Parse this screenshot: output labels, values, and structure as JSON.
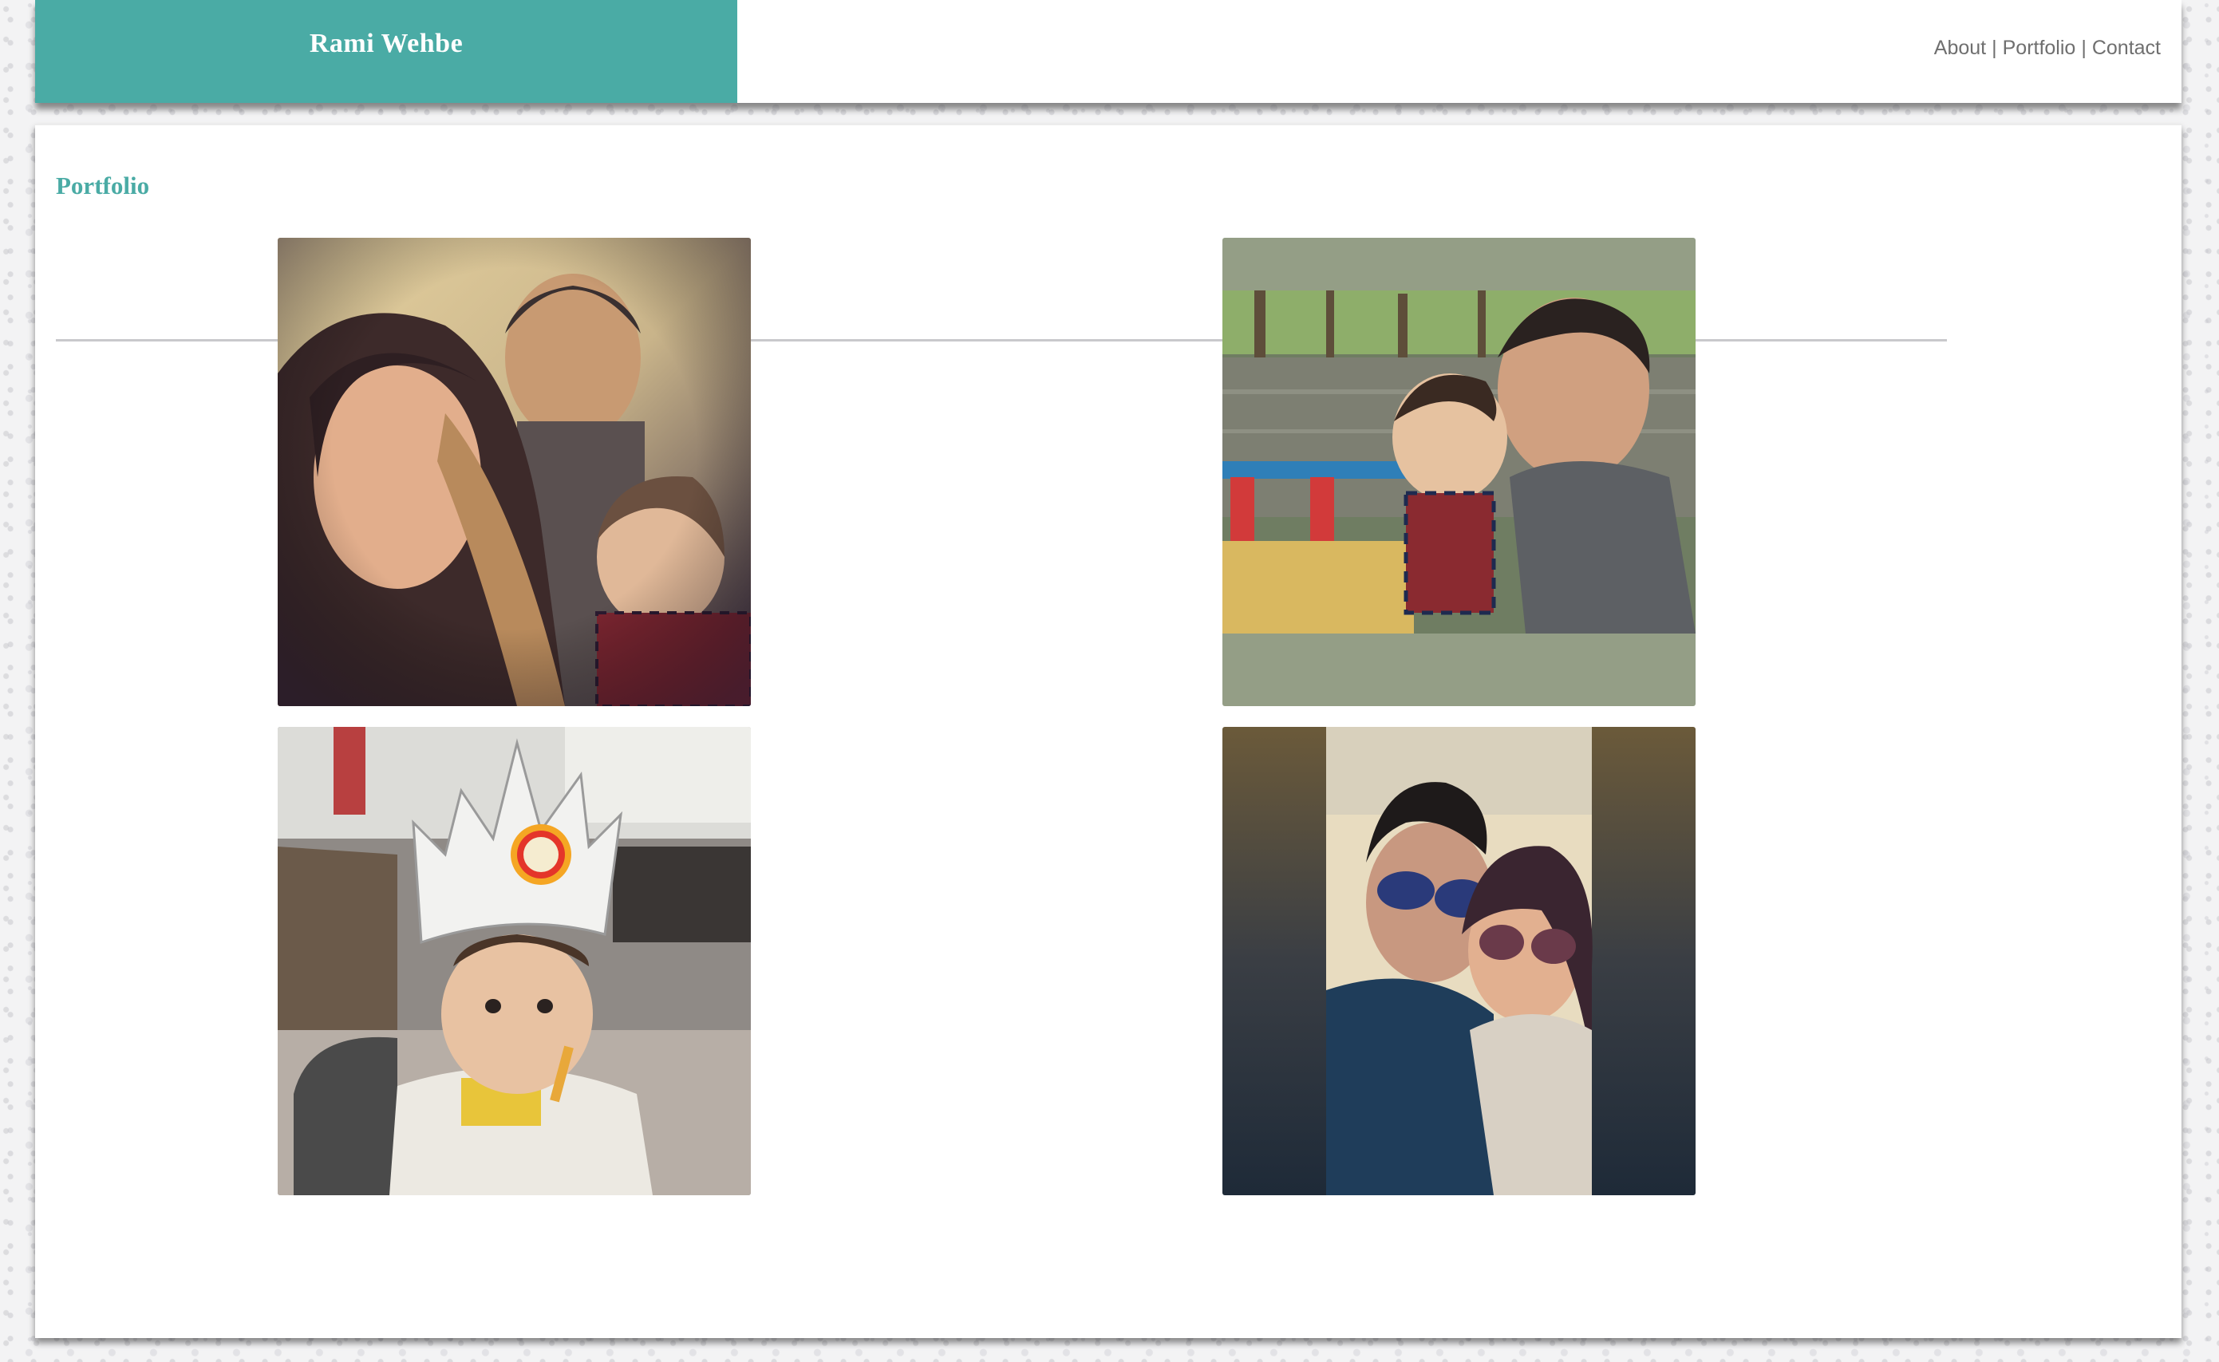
{
  "header": {
    "brand": "Rami Wehbe",
    "nav": [
      {
        "label": "About"
      },
      {
        "label": "Portfolio"
      },
      {
        "label": "Contact"
      }
    ],
    "separator": "|"
  },
  "main": {
    "title": "Portfolio"
  },
  "colors": {
    "accent": "#4aaba5",
    "nav_text": "#6f6f6f",
    "divider": "#c9c9cc"
  }
}
